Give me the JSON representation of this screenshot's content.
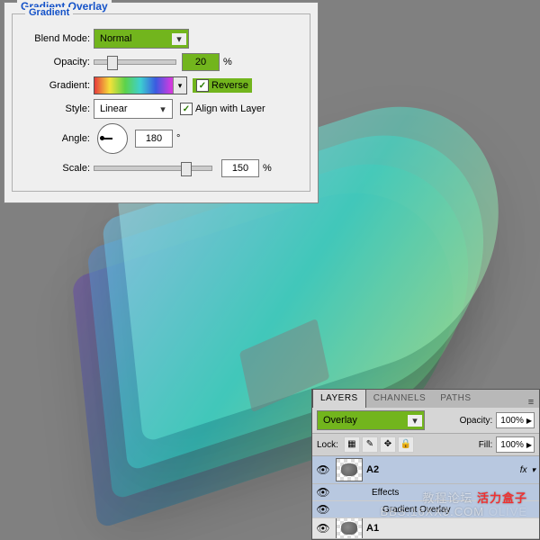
{
  "dialog": {
    "title": "Gradient Overlay",
    "group": "Gradient",
    "blend_mode_label": "Blend Mode:",
    "blend_mode_value": "Normal",
    "opacity_label": "Opacity:",
    "opacity_value": "20",
    "opacity_unit": "%",
    "gradient_label": "Gradient:",
    "reverse_label": "Reverse",
    "style_label": "Style:",
    "style_value": "Linear",
    "align_label": "Align with Layer",
    "angle_label": "Angle:",
    "angle_value": "180",
    "angle_unit": "°",
    "scale_label": "Scale:",
    "scale_value": "150",
    "scale_unit": "%",
    "highlights": [
      "blend_mode",
      "opacity_value",
      "reverse"
    ]
  },
  "layers_panel": {
    "tabs": [
      "LAYERS",
      "CHANNELS",
      "PATHS"
    ],
    "active_tab": 0,
    "blend_mode": "Overlay",
    "opacity_label": "Opacity:",
    "opacity_value": "100%",
    "lock_label": "Lock:",
    "fill_label": "Fill:",
    "fill_value": "100%",
    "layers": [
      {
        "name": "A2",
        "visible": true,
        "selected": true,
        "has_fx": true,
        "effects_label": "Effects",
        "effect_items": [
          "Gradient Overlay"
        ]
      },
      {
        "name": "A1",
        "visible": true,
        "selected": false
      }
    ],
    "fx_label": "fx"
  },
  "watermark": {
    "line1": "教程论坛",
    "red": "活力盒子",
    "line2": "BBS.16XX8.COM",
    "line3": "OLIVE"
  }
}
